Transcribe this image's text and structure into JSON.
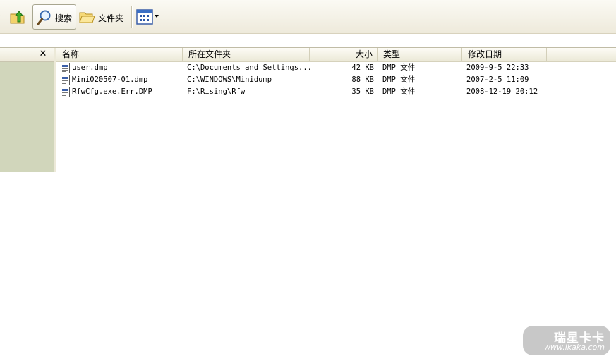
{
  "toolbar": {
    "search_label": "搜索",
    "folders_label": "文件夹",
    "left_separator_glyph": "·"
  },
  "left_pane": {
    "close_glyph": "✕"
  },
  "columns": {
    "name": "名称",
    "path": "所在文件夹",
    "size": "大小",
    "type": "类型",
    "modified": "修改日期"
  },
  "files": [
    {
      "name": "user.dmp",
      "path": "C:\\Documents and Settings...",
      "size": "42 KB",
      "type": "DMP 文件",
      "modified": "2009-9-5 22:33"
    },
    {
      "name": "Mini020507-01.dmp",
      "path": "C:\\WINDOWS\\Minidump",
      "size": "88 KB",
      "type": "DMP 文件",
      "modified": "2007-2-5 11:09"
    },
    {
      "name": "RfwCfg.exe.Err.DMP",
      "path": "F:\\Rising\\Rfw",
      "size": "35 KB",
      "type": "DMP 文件",
      "modified": "2008-12-19 20:12"
    }
  ],
  "watermark": {
    "brand": "瑞星卡卡",
    "url": "www.ikaka.com"
  },
  "icons": [
    "up-folder-icon",
    "search-icon",
    "folders-icon",
    "views-icon",
    "dmp-file-icon"
  ],
  "colors": {
    "toolbar_bg": "#eeeadb",
    "left_pane_bg": "#d1d6bb",
    "header_bg": "#ebe8d6"
  }
}
